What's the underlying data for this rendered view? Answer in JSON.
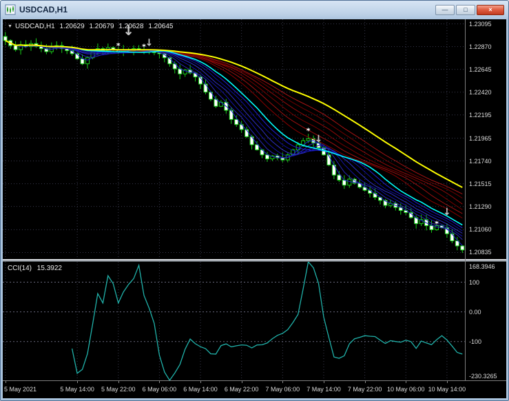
{
  "window": {
    "title": "USDCAD,H1",
    "controls": [
      {
        "name": "minimize-icon",
        "glyph": "—"
      },
      {
        "name": "maximize-icon",
        "glyph": "□"
      },
      {
        "name": "close-icon",
        "glyph": "×"
      }
    ]
  },
  "chart_data": {
    "type": "candlestick",
    "symbol": "USDCAD",
    "timeframe": "H1",
    "info_line": {
      "collapse_icon": "▼",
      "symbol": "USDCAD,H1",
      "open": "1.20629",
      "high": "1.20679",
      "low": "1.20628",
      "close": "1.20645"
    },
    "price_scale": {
      "labels": [
        "1.23095",
        "1.22870",
        "1.22645",
        "1.22420",
        "1.22195",
        "1.21965",
        "1.21740",
        "1.21515",
        "1.21290",
        "1.21060",
        "1.20835"
      ],
      "top_value": 1.2314,
      "bottom_value": 1.2077
    },
    "time_axis": {
      "labels": [
        {
          "text": "5 May 2021",
          "index": 0
        },
        {
          "text": "5 May 14:00",
          "index": 14
        },
        {
          "text": "5 May 22:00",
          "index": 22
        },
        {
          "text": "6 May 06:00",
          "index": 30
        },
        {
          "text": "6 May 14:00",
          "index": 38
        },
        {
          "text": "6 May 22:00",
          "index": 46
        },
        {
          "text": "7 May 06:00",
          "index": 54
        },
        {
          "text": "7 May 14:00",
          "index": 62
        },
        {
          "text": "7 May 22:00",
          "index": 70
        },
        {
          "text": "10 May 06:00",
          "index": 78
        },
        {
          "text": "10 May 14:00",
          "index": 86
        }
      ]
    },
    "candles": {
      "count": 90,
      "closes": [
        1.2293,
        1.2288,
        1.2284,
        1.2289,
        1.2287,
        1.229,
        1.2287,
        1.2285,
        1.2282,
        1.2286,
        1.2288,
        1.2285,
        1.2283,
        1.228,
        1.2275,
        1.227,
        1.2276,
        1.2282,
        1.2285,
        1.2283,
        1.2286,
        1.2284,
        1.2282,
        1.2284,
        1.2283,
        1.2285,
        1.2284,
        1.2282,
        1.2283,
        1.2281,
        1.228,
        1.2276,
        1.227,
        1.2265,
        1.226,
        1.2264,
        1.2261,
        1.2257,
        1.225,
        1.2242,
        1.2235,
        1.2228,
        1.2232,
        1.2224,
        1.2215,
        1.221,
        1.2205,
        1.2198,
        1.219,
        1.2185,
        1.218,
        1.2176,
        1.2179,
        1.2177,
        1.2175,
        1.218,
        1.2185,
        1.219,
        1.2194,
        1.2196,
        1.2192,
        1.2187,
        1.218,
        1.217,
        1.216,
        1.2155,
        1.215,
        1.2156,
        1.2152,
        1.2148,
        1.2145,
        1.2142,
        1.2138,
        1.2135,
        1.213,
        1.2132,
        1.2128,
        1.2125,
        1.2123,
        1.2118,
        1.2112,
        1.2116,
        1.211,
        1.2106,
        1.211,
        1.2108,
        1.2102,
        1.2095,
        1.209,
        1.2086
      ]
    },
    "indicators": {
      "ribbons": [
        {
          "name": "red-ma",
          "periods": [
            20,
            23,
            26,
            29,
            32,
            35
          ],
          "colors": [
            "#8B0000",
            "#A01010",
            "#780000",
            "#960A0A",
            "#700000",
            "#AA1414"
          ],
          "width": 1
        },
        {
          "name": "blue-ma",
          "periods": [
            3,
            5,
            7,
            9,
            11,
            13
          ],
          "colors": [
            "#1C1CCE",
            "#2828B8",
            "#1414A8",
            "#3030C8",
            "#0F0F9E",
            "#2020DC"
          ],
          "width": 1
        }
      ],
      "ma_lines": [
        {
          "name": "cyan-ma",
          "period": 15,
          "color": "#00FFFF",
          "width": 1.6
        },
        {
          "name": "yellow-ma",
          "period": 42,
          "color": "#FFFF00",
          "width": 2
        }
      ]
    },
    "markers": [
      {
        "type": "star-signal",
        "glyph": "*",
        "index": 22,
        "price": 1.2288,
        "size": 11,
        "color": "#FFFFFF"
      },
      {
        "type": "arrow-down-signal",
        "glyph": "↓",
        "index": 24,
        "price": 1.2303,
        "size": 20,
        "color": "#C8C8C8"
      },
      {
        "type": "star-signal",
        "glyph": "*",
        "index": 27,
        "price": 1.2287,
        "size": 11,
        "color": "#FFFFFF"
      },
      {
        "type": "arrow-down-signal",
        "glyph": "↓",
        "index": 28,
        "price": 1.2291,
        "size": 14,
        "color": "#C8C8C8"
      },
      {
        "type": "star-signal",
        "glyph": "*",
        "index": 59,
        "price": 1.2204,
        "size": 11,
        "color": "#FFFFFF"
      },
      {
        "type": "arrow-down-signal",
        "glyph": "↓",
        "index": 61,
        "price": 1.2196,
        "size": 14,
        "color": "#C8C8C8"
      },
      {
        "type": "star-signal",
        "glyph": "*",
        "index": 84,
        "price": 1.2112,
        "size": 11,
        "color": "#FFFFFF"
      },
      {
        "type": "arrow-down-signal",
        "glyph": "↓",
        "index": 86,
        "price": 1.2124,
        "size": 14,
        "color": "#C8C8C8"
      }
    ],
    "cci_pane": {
      "name": "CCI(14)",
      "value": "15.3922",
      "period": 14,
      "color": "#20B2AA",
      "levels": [
        100,
        0,
        -100
      ],
      "scale_labels": [
        {
          "text": "168.3946",
          "value": 168.3946
        },
        {
          "text": "100",
          "value": 100
        },
        {
          "text": "0.00",
          "value": 0
        },
        {
          "text": "-100",
          "value": -100
        },
        {
          "text": "-230.3265",
          "value": -230.3265
        }
      ]
    },
    "colors": {
      "background": "#000000",
      "grid": "#3A3A4E",
      "level": "#6A6A7E",
      "bull_body": "#000000",
      "bear_body": "#FFFFFF",
      "candle_border": "#18D018",
      "scale_text": "#DCDCDC"
    }
  }
}
